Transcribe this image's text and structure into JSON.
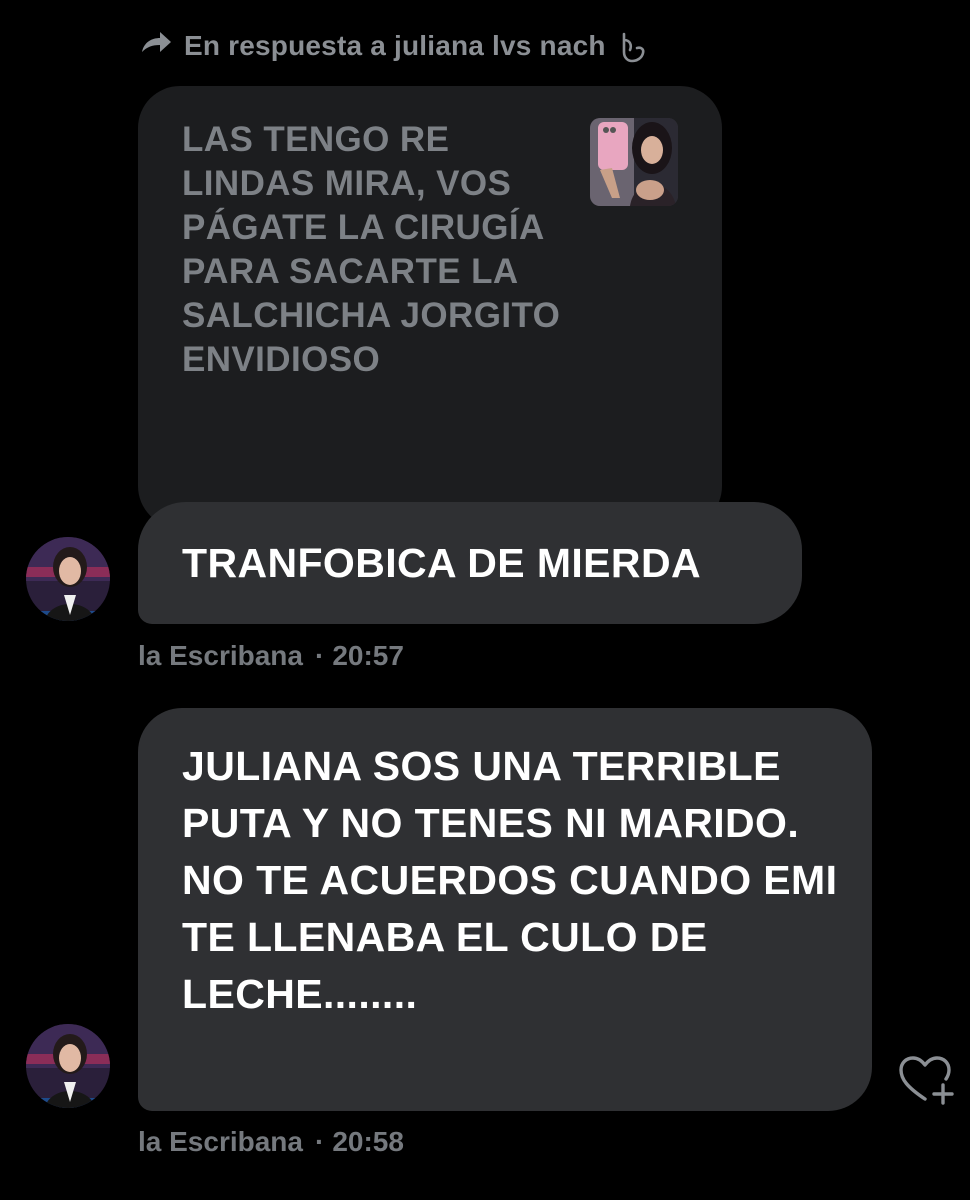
{
  "reply_context": {
    "text": "En respuesta a juliana lvs nach",
    "arrow_icon": "reply-arrow-icon",
    "emoji_icon": "emoji-icon"
  },
  "quoted_message": {
    "text": "LAS TENGO RE LINDAS MIRA, VOS PÁGATE LA CIRUGÍA PARA SACARTE LA SALCHICHA JORGITO ENVIDIOSO",
    "has_image": true
  },
  "messages": [
    {
      "text": "TRANFOBICA DE MIERDA",
      "sender": "la Escribana",
      "separator": "·",
      "time": "20:57"
    },
    {
      "text": "JULIANA SOS UNA TERRIBLE PUTA Y NO TENES NI MARIDO. NO TE ACUERDOS CUANDO EMI TE LLENABA EL CULO DE LECHE........",
      "sender": "la Escribana",
      "separator": "·",
      "time": "20:58"
    }
  ],
  "colors": {
    "background": "#000000",
    "bubble": "#2f3033",
    "quoted_bubble": "#1c1d1f",
    "muted_text": "#8b8f94"
  },
  "icons": {
    "like": "heart-plus-icon"
  }
}
